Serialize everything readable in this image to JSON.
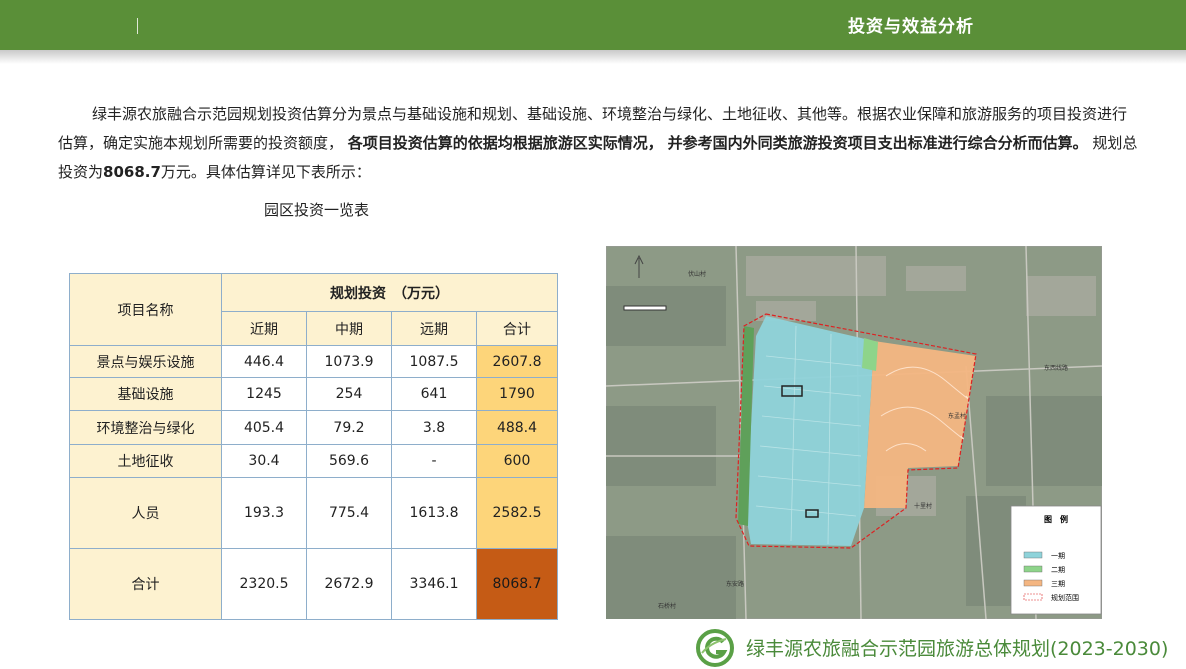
{
  "header": {
    "title": "投资与效益分析"
  },
  "intro": {
    "part1": "绿丰源农旅融合示范园规划投资估算分为景点与基础设施和规划、基础设施、环境整治与绿化、土地征收、其他等。根据农业保障和旅游服务的项目投资进行估算，确定实施本规划所需要的投资额度，",
    "bold1": "各项目投资估算的依据均根据旅游区实际情况，",
    "bold2": "并参考国内外同类旅游投资项目支出标准进行综合分析而估算。",
    "part2": "规划总投资为",
    "total": "8068.7",
    "part3": "万元。具体估算详见下表所示："
  },
  "table": {
    "caption": "园区投资一览表",
    "name_header": "项目名称",
    "group_header": "规划投资　（万元）",
    "columns": [
      "近期",
      "中期",
      "远期",
      "合计"
    ],
    "rows": [
      {
        "name": "景点与娱乐设施",
        "values": [
          "446.4",
          "1073.9",
          "1087.5",
          "2607.8"
        ]
      },
      {
        "name": "基础设施",
        "values": [
          "1245",
          "254",
          "641",
          "1790"
        ]
      },
      {
        "name": "环境整治与绿化",
        "values": [
          "405.4",
          "79.2",
          "3.8",
          "488.4"
        ]
      },
      {
        "name": "土地征收",
        "values": [
          "30.4",
          "569.6",
          "-",
          "600"
        ]
      },
      {
        "name": "人员",
        "values": [
          "193.3",
          "775.4",
          "1613.8",
          "2582.5"
        ]
      },
      {
        "name": "合计",
        "values": [
          "2320.5",
          "2672.9",
          "3346.1",
          "8068.7"
        ]
      }
    ]
  },
  "map": {
    "legend_title": "图　例",
    "legend": [
      {
        "label": "一期",
        "color": "#8fd3da"
      },
      {
        "label": "二期",
        "color": "#8ed48a"
      },
      {
        "label": "三期",
        "color": "#f4b682"
      },
      {
        "label": "规划范围",
        "color": "#ffffff"
      }
    ],
    "labels": [
      "东西线路",
      "伏山村",
      "东孟村",
      "十里村",
      "石桥村",
      "东安路"
    ]
  },
  "footer": {
    "title": "绿丰源农旅融合示范园旅游总体规划(2023-2030)"
  },
  "colors": {
    "header": "#5a8f38",
    "table_header": "#fdf2d0",
    "subtotal": "#fdd57a",
    "grand_total": "#c55b15"
  }
}
